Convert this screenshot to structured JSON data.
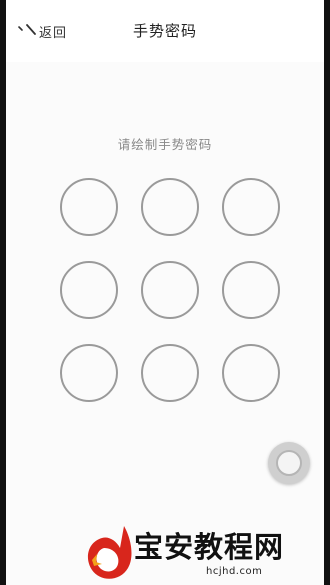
{
  "nav": {
    "back_label": "返回",
    "title": "手势密码"
  },
  "gesture": {
    "prompt": "请绘制手势密码",
    "dots": [
      {
        "id": "dot-1-1"
      },
      {
        "id": "dot-1-2"
      },
      {
        "id": "dot-1-3"
      },
      {
        "id": "dot-2-1"
      },
      {
        "id": "dot-2-2"
      },
      {
        "id": "dot-2-3"
      },
      {
        "id": "dot-3-1"
      },
      {
        "id": "dot-3-2"
      },
      {
        "id": "dot-3-3"
      }
    ]
  },
  "assistive_touch": {
    "icon": "assistive-touch-icon"
  },
  "watermark": {
    "brand": "宝安教程网",
    "url": "hcjhd.com",
    "logo_icon": "flame-d-logo",
    "colors": {
      "logo_red": "#d8261c",
      "logo_orange": "#f3a21b"
    }
  },
  "colors": {
    "screen_bg": "#fbfbfb",
    "dot_border": "#9a9a9a",
    "prompt_text": "#888888"
  }
}
